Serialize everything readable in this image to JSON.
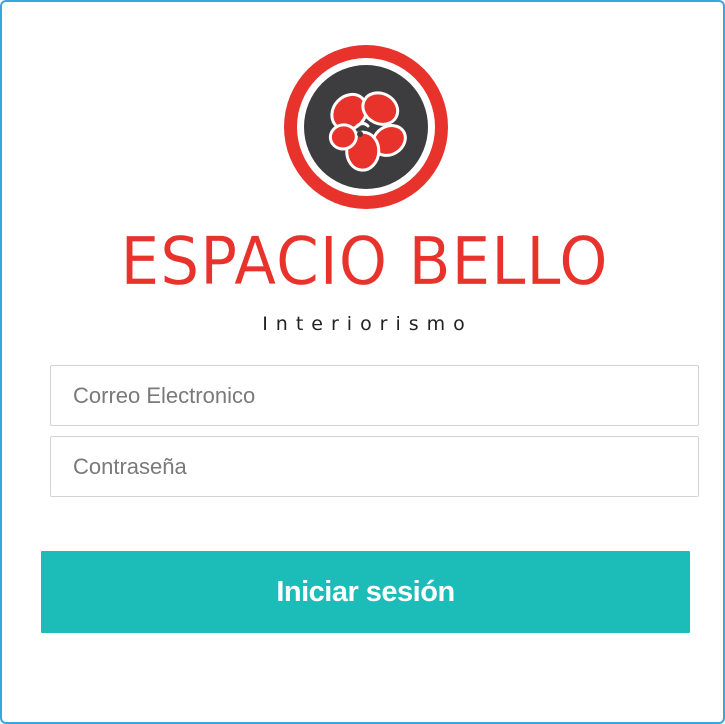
{
  "brand": {
    "name": "ESPACIO BELLO",
    "tagline": "Interiorismo",
    "logo_icon": "flower-logo-icon",
    "colors": {
      "brand_red": "#e8322c",
      "logo_dark": "#3d3d3f"
    }
  },
  "form": {
    "email": {
      "placeholder": "Correo Electronico",
      "value": ""
    },
    "password": {
      "placeholder": "Contraseña",
      "value": ""
    },
    "submit_label": "Iniciar sesión",
    "accent_color": "#1cbcb8",
    "frame_border_color": "#3aa6df"
  }
}
